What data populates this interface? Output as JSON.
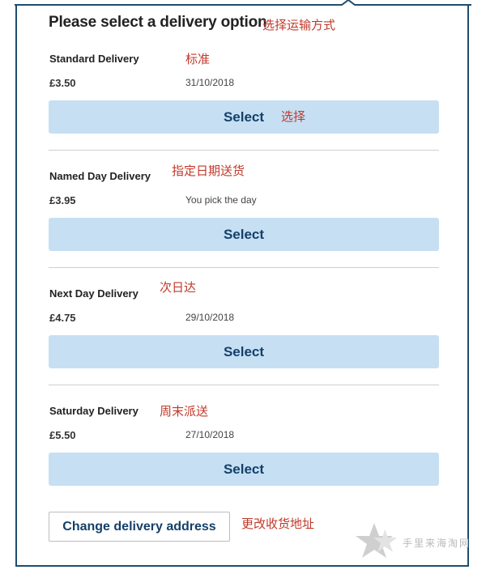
{
  "title": "Please select a delivery option",
  "title_note": "选择运输方式",
  "options": [
    {
      "name": "Standard Delivery",
      "note": "标准",
      "price": "£3.50",
      "date": "31/10/2018",
      "select_label": "Select",
      "select_note": "选择"
    },
    {
      "name": "Named Day Delivery",
      "note": "指定日期送货",
      "price": "£3.95",
      "date": "You pick the day",
      "select_label": "Select"
    },
    {
      "name": "Next Day Delivery",
      "note": "次日达",
      "price": "£4.75",
      "date": "29/10/2018",
      "select_label": "Select"
    },
    {
      "name": "Saturday Delivery",
      "note": "周末派送",
      "price": "£5.50",
      "date": "27/10/2018",
      "select_label": "Select"
    }
  ],
  "change_address": {
    "label": "Change delivery address",
    "note": "更改收货地址"
  },
  "watermark": {
    "text": "手里来海淘网",
    "icon": "star-icon"
  },
  "colors": {
    "frame": "#1f4d6e",
    "button_bg": "#c6dff3",
    "button_text": "#14406a",
    "annotation": "#c0392b"
  }
}
